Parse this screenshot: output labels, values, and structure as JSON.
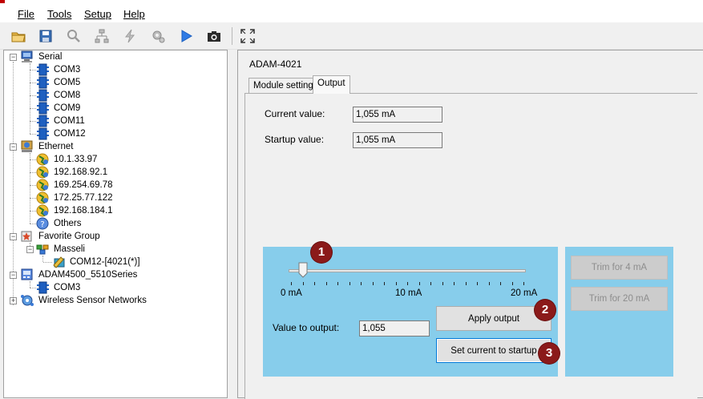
{
  "menu": {
    "file_label": "File",
    "tools_label": "Tools",
    "setup_label": "Setup",
    "help_label": "Help"
  },
  "toolbar": {
    "icons": [
      "open-folder-icon",
      "save-icon",
      "search-icon",
      "network-icon",
      "flash-icon",
      "settings-icon",
      "run-icon",
      "camera-icon",
      "fullscreen-icon"
    ]
  },
  "tree": {
    "serial": {
      "label": "Serial",
      "children": [
        "COM3",
        "COM5",
        "COM8",
        "COM9",
        "COM11",
        "COM12"
      ]
    },
    "ethernet": {
      "label": "Ethernet",
      "children": [
        "10.1.33.97",
        "192.168.92.1",
        "169.254.69.78",
        "172.25.77.122",
        "192.168.184.1",
        "Others"
      ]
    },
    "favorite": {
      "label": "Favorite Group",
      "group": "Masseli",
      "device": "COM12-[4021(*)]"
    },
    "adam4500": {
      "label": "ADAM4500_5510Series",
      "children": [
        "COM3"
      ]
    },
    "wsn": {
      "label": "Wireless Sensor Networks"
    }
  },
  "module": {
    "title": "ADAM-4021",
    "tabs": [
      "Module setting",
      "Output"
    ],
    "active_tab": "Output",
    "current_label": "Current value:",
    "current_value": "1,055 mA",
    "startup_label": "Startup value:",
    "startup_value": "1,055 mA"
  },
  "output": {
    "slider_value_ma": 1.055,
    "slider_min_ma": 0,
    "slider_max_ma": 20,
    "tick_labels": [
      "0 mA",
      "10 mA",
      "20 mA"
    ],
    "value_label": "Value to output:",
    "value": "1,055",
    "apply_label": "Apply output",
    "set_startup_label": "Set current to startup"
  },
  "trim": {
    "trim4_label": "Trim for 4 mA",
    "trim20_label": "Trim for 20 mA"
  },
  "badges": [
    "1",
    "2",
    "3"
  ],
  "colors": {
    "panel_blue": "#87cdeb",
    "badge": "#8b1a1a",
    "focus": "#0078d7"
  }
}
